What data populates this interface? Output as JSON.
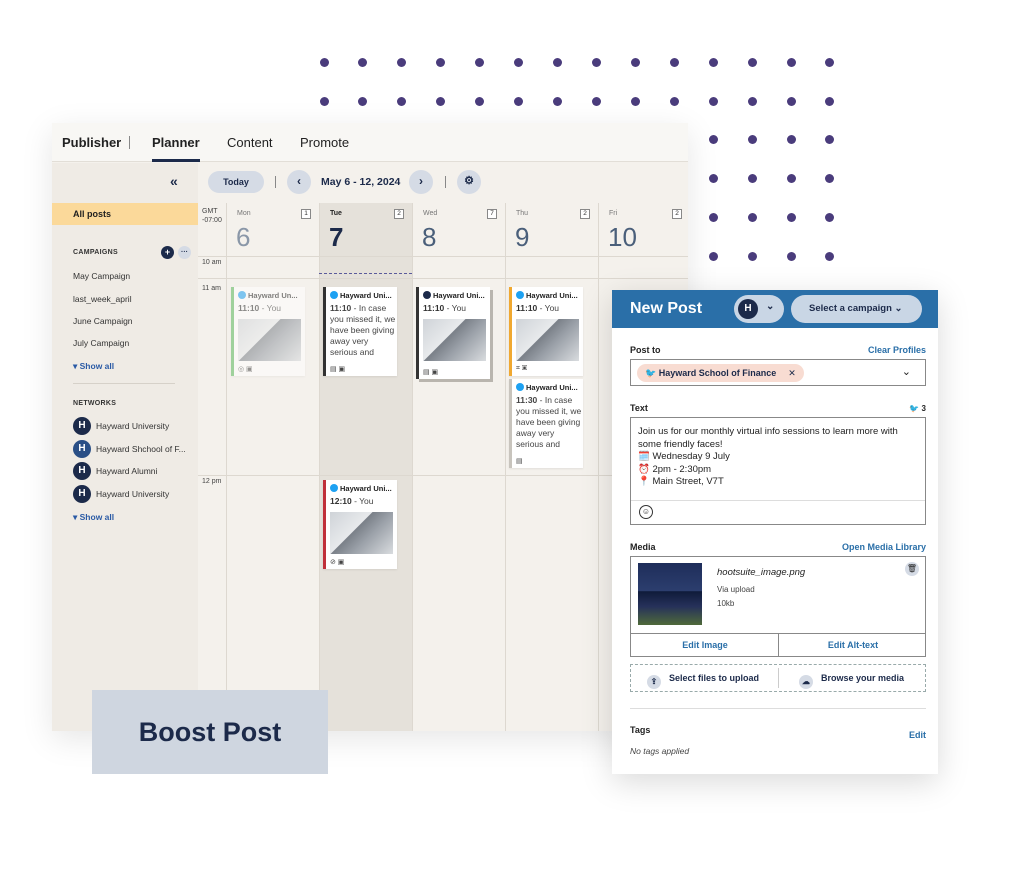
{
  "nav": {
    "publisher": "Publisher",
    "planner": "Planner",
    "content": "Content",
    "promote": "Promote"
  },
  "sidebar": {
    "collapse": "«",
    "all_posts": "All posts",
    "campaigns_heading": "CAMPAIGNS",
    "add_icon": "+",
    "more_icon": "···",
    "campaigns": [
      "May Campaign",
      "last_week_april",
      "June Campaign",
      "July Campaign"
    ],
    "campaigns_show_all": "Show all",
    "networks_heading": "NETWORKS",
    "networks": [
      "Hayward University",
      "Hayward Shchool of F...",
      "Hayward Alumni",
      "Hayward University"
    ],
    "networks_show_all": "Show all"
  },
  "toolbar": {
    "today": "Today",
    "prev": "‹",
    "next": "›",
    "date_range": "May 6 - 12, 2024",
    "settings": "⚙"
  },
  "calendar": {
    "gmt": "GMT",
    "offset": "-07:00",
    "days": [
      {
        "name": "Mon",
        "num": "6",
        "count": "1"
      },
      {
        "name": "Tue",
        "num": "7",
        "count": "2"
      },
      {
        "name": "Wed",
        "num": "8",
        "count": "7"
      },
      {
        "name": "Thu",
        "num": "9",
        "count": "2"
      },
      {
        "name": "Fri",
        "num": "10",
        "count": "2"
      }
    ],
    "times": [
      "10 am",
      "11 am",
      "12 pm"
    ],
    "posts": {
      "mon": {
        "title": "Hayward Un...",
        "time": "11:10",
        "by": " - You"
      },
      "tue1": {
        "title": "Hayward Uni...",
        "time": "11:10",
        "text": " - In case you missed it, we have been giving away very serious and"
      },
      "wed": {
        "title": "Hayward Uni...",
        "time": "11:10",
        "by": " - You"
      },
      "thu1": {
        "title": "Hayward Uni...",
        "time": "11:10",
        "by": " - You"
      },
      "thu2": {
        "title": "Hayward Uni...",
        "time": "11:30",
        "text": " - In case you missed it, we have been giving away very serious and"
      },
      "tue2": {
        "title": "Hayward Uni...",
        "time": "12:10",
        "by": " - You"
      }
    }
  },
  "boost": {
    "label": "Boost Post"
  },
  "new_post": {
    "title": "New Post",
    "select_campaign": "Select a campaign",
    "post_to_label": "Post to",
    "clear_profiles": "Clear Profiles",
    "profile_chip": "Hayward School of Finance",
    "text_label": "Text",
    "twitter_count": "3",
    "text_lines": [
      "Join us for our monthly virtual info sessions to learn more with",
      "some friendly faces!",
      "🗓️ Wednesday 9 July",
      "⏰ 2pm - 2:30pm",
      "📍 Main Street, V7T"
    ],
    "media_label": "Media",
    "open_media_library": "Open Media Library",
    "file_name": "hootsuite_image.png",
    "file_source": "Via upload",
    "file_size": "10kb",
    "edit_image": "Edit Image",
    "edit_alt": "Edit Alt-text",
    "select_files": "Select files to upload",
    "browse_media": "Browse your media",
    "tags_label": "Tags",
    "tags_edit": "Edit",
    "no_tags": "No tags applied"
  },
  "colors": {
    "accent": "#2a6fa8",
    "navy": "#1c2a4a",
    "dots": "#4a3c7c",
    "all_posts_bg": "#fbd99a"
  }
}
